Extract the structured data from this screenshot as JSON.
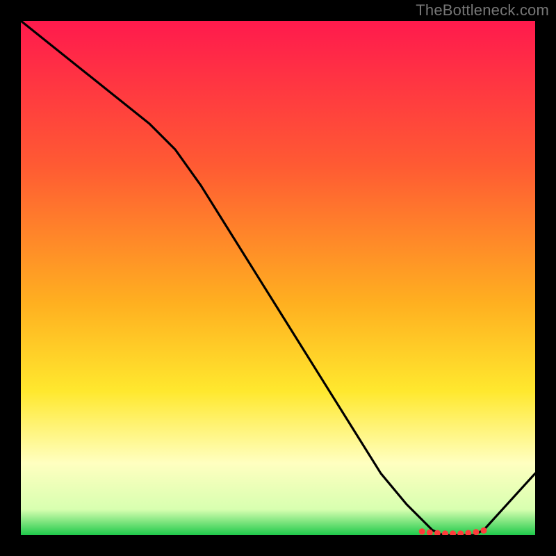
{
  "watermark": "TheBottleneck.com",
  "colors": {
    "grad0": "#ff1a4d",
    "grad25": "#ff5a33",
    "grad50": "#ffb020",
    "grad70": "#ffe82e",
    "grad85": "#ffffc0",
    "grad95": "#d8ffb0",
    "grad100": "#1fc94a",
    "line": "#000000",
    "marker": "#ff3b3b"
  },
  "chart_data": {
    "type": "line",
    "title": "",
    "xlabel": "",
    "ylabel": "",
    "xlim": [
      0,
      100
    ],
    "ylim": [
      0,
      100
    ],
    "series": [
      {
        "name": "curve",
        "x": [
          0,
          5,
          10,
          15,
          20,
          25,
          30,
          35,
          40,
          45,
          50,
          55,
          60,
          65,
          70,
          75,
          80,
          82,
          85,
          88,
          90,
          100
        ],
        "values": [
          100,
          96,
          92,
          88,
          84,
          80,
          75,
          68,
          60,
          52,
          44,
          36,
          28,
          20,
          12,
          6,
          1,
          0,
          0,
          0,
          1,
          12
        ]
      }
    ],
    "markers": {
      "name": "highlight-points",
      "x": [
        78,
        79.5,
        81,
        82.5,
        84,
        85.5,
        87,
        88.5,
        90
      ],
      "values": [
        0.7,
        0.5,
        0.4,
        0.3,
        0.3,
        0.3,
        0.4,
        0.6,
        0.9
      ]
    }
  }
}
